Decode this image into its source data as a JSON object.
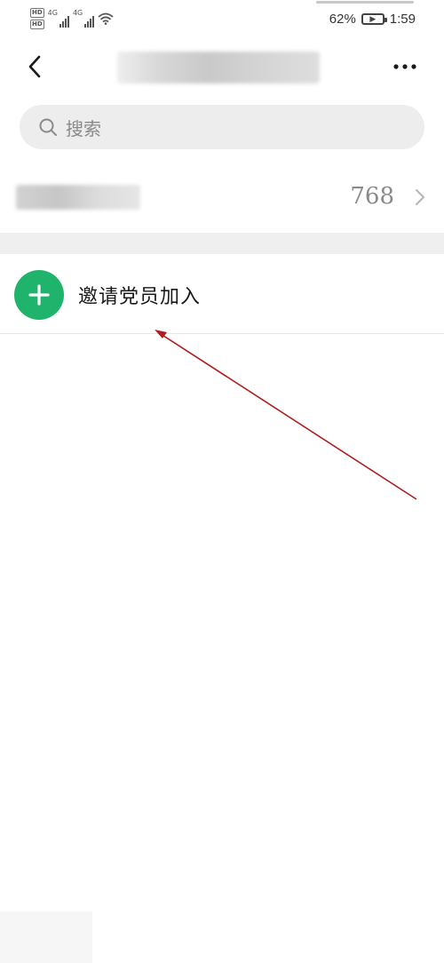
{
  "status_bar": {
    "hd_badge_1": "HD",
    "hd_badge_2": "HD",
    "network_1": "4G",
    "network_2": "4G",
    "battery_percent": "62%",
    "time": "1:59",
    "icons": [
      "hd-icon",
      "signal-icon",
      "wifi-icon",
      "battery-charging-icon"
    ]
  },
  "header": {
    "back_icon": "chevron-left-icon",
    "more_icon": "more-dots-icon"
  },
  "search": {
    "placeholder": "搜索",
    "icon": "search-icon"
  },
  "count_row": {
    "value": "768",
    "icon": "chevron-right-icon"
  },
  "invite": {
    "label": "邀请党员加入",
    "icon": "plus-icon",
    "icon_color": "#20b36b"
  },
  "annotation": {
    "color": "#b01d1d"
  }
}
